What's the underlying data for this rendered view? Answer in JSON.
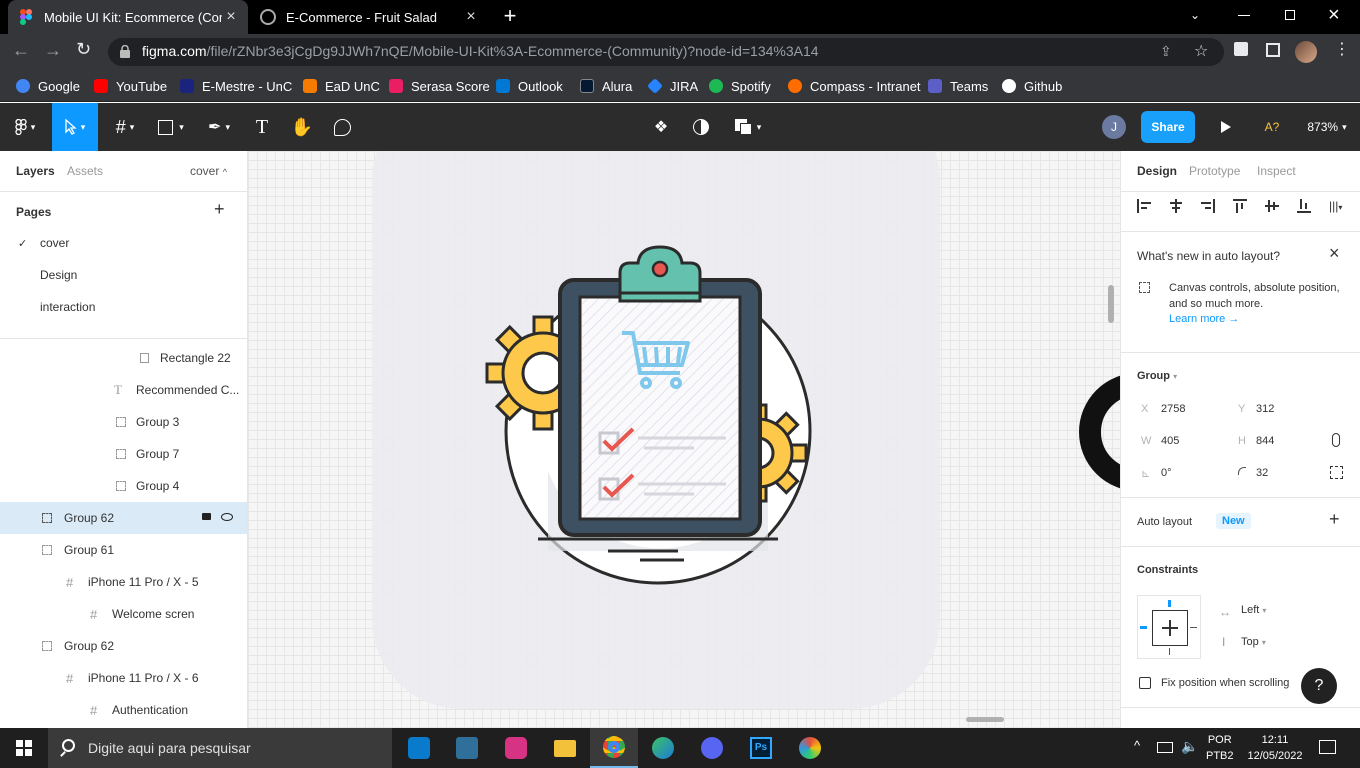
{
  "browser": {
    "tabs": [
      {
        "title": "Mobile UI Kit: Ecommerce (Comm",
        "active": true
      },
      {
        "title": "E-Commerce - Fruit Salad",
        "active": false
      }
    ],
    "new_tab": "+",
    "url_host": "figma.com",
    "url_path": "/file/rZNbr3e3jCgDg9JJWh7nQE/Mobile-UI-Kit%3A-Ecommerce-(Community)?node-id=134%3A14",
    "bookmarks": [
      {
        "label": "Google",
        "color": "#4285f4"
      },
      {
        "label": "YouTube",
        "color": "#ff0000"
      },
      {
        "label": "E-Mestre - UnC",
        "color": "#1a237e"
      },
      {
        "label": "EaD UnC",
        "color": "#f57c00"
      },
      {
        "label": "Serasa Score",
        "color": "#e91e63"
      },
      {
        "label": "Outlook",
        "color": "#0078d4"
      },
      {
        "label": "Alura",
        "color": "#051933"
      },
      {
        "label": "JIRA",
        "color": "#2684ff"
      },
      {
        "label": "Spotify",
        "color": "#1db954"
      },
      {
        "label": "Compass - Intranet",
        "color": "#ff6d00"
      },
      {
        "label": "Teams",
        "color": "#5b5fc7"
      },
      {
        "label": "Github",
        "color": "#ffffff"
      }
    ]
  },
  "figma_toolbar": {
    "avatar_letter": "J",
    "share_label": "Share",
    "font_warning": "A?",
    "zoom": "873%"
  },
  "left_panel": {
    "tab_layers": "Layers",
    "tab_assets": "Assets",
    "current_page_label": "cover",
    "pages_title": "Pages",
    "pages": [
      {
        "name": "cover",
        "current": true
      },
      {
        "name": "Design",
        "current": false
      },
      {
        "name": "interaction",
        "current": false
      }
    ],
    "layers": [
      {
        "name": "Rectangle 22",
        "icon": "rectangle-icon",
        "indent": 3
      },
      {
        "name": "Recommended C...",
        "icon": "text-icon",
        "indent": 2
      },
      {
        "name": "Group 3",
        "icon": "group-icon",
        "indent": 2
      },
      {
        "name": "Group 7",
        "icon": "group-icon",
        "indent": 2
      },
      {
        "name": "Group 4",
        "icon": "group-icon",
        "indent": 2
      },
      {
        "name": "Group 62",
        "icon": "group-icon",
        "indent": 1,
        "selected": true
      },
      {
        "name": "Group 61",
        "icon": "group-icon",
        "indent": 1
      },
      {
        "name": "iPhone 11 Pro / X - 5",
        "icon": "frame-icon",
        "indent": 2
      },
      {
        "name": "Welcome scren",
        "icon": "frame-icon",
        "indent": 3
      },
      {
        "name": "Group 62",
        "icon": "group-icon",
        "indent": 1
      },
      {
        "name": "iPhone 11 Pro / X - 6",
        "icon": "frame-icon",
        "indent": 2
      },
      {
        "name": "Authentication",
        "icon": "frame-icon",
        "indent": 3
      }
    ]
  },
  "right_panel": {
    "tabs": [
      "Design",
      "Prototype",
      "Inspect"
    ],
    "whats_new": {
      "title": "What's new in auto layout?",
      "body": "Canvas controls, absolute position, and so much more.",
      "link": "Learn more →"
    },
    "group": {
      "title": "Group",
      "x_label": "X",
      "x": "2758",
      "y_label": "Y",
      "y": "312",
      "w_label": "W",
      "w": "405",
      "h_label": "H",
      "h": "844",
      "rotation": "0°",
      "radius": "32"
    },
    "auto_layout": {
      "label": "Auto layout",
      "badge": "New"
    },
    "constraints": {
      "title": "Constraints",
      "horizontal": "Left",
      "vertical": "Top",
      "fix_label": "Fix position when scrolling"
    },
    "help": "?"
  },
  "taskbar": {
    "search_placeholder": "Digite aqui para pesquisar",
    "lang": "POR",
    "layout": "PTB2",
    "time": "12:11",
    "date": "12/05/2022"
  },
  "colors": {
    "figma_blue": "#0d99ff",
    "share_blue": "#18a0fb",
    "selected_row": "#daebf7",
    "clipboard_frame": "#3d5163",
    "clip_teal": "#63c1ad",
    "gear_yellow": "#fec84b",
    "cart_blue": "#7fc8ec",
    "check_red": "#e8574f"
  }
}
